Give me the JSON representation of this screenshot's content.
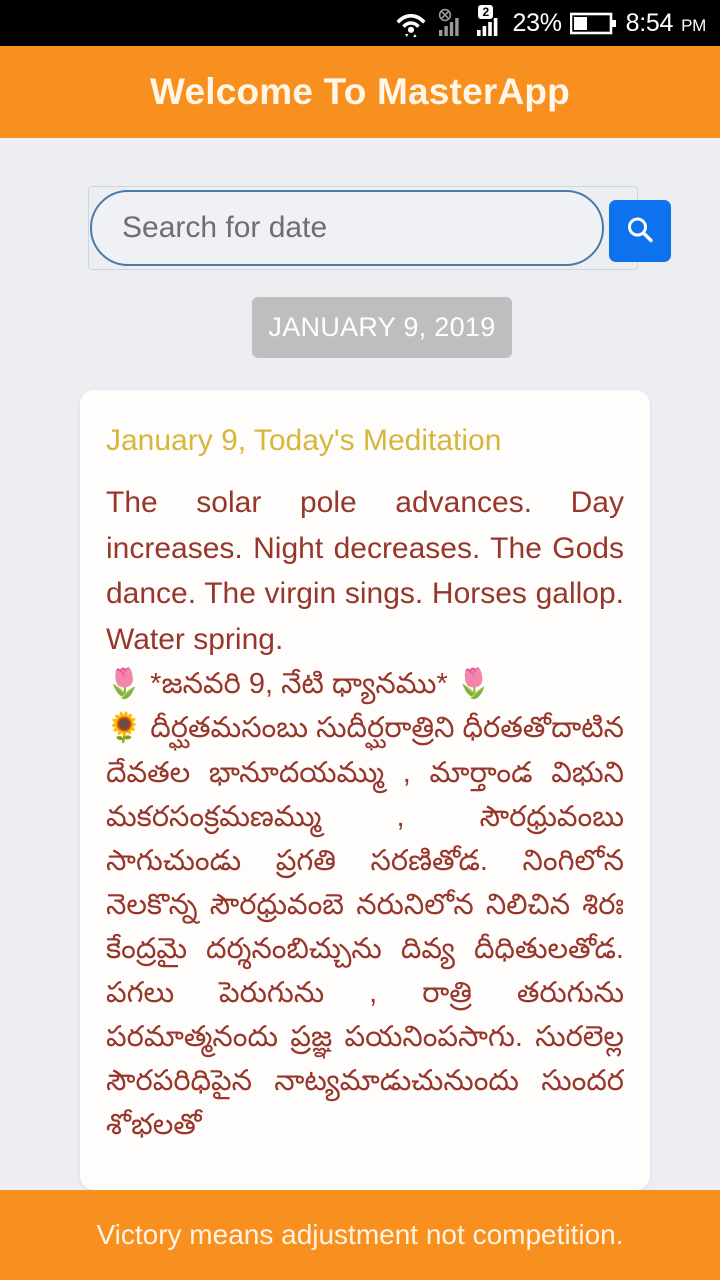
{
  "status_bar": {
    "wifi_icon": "wifi-icon",
    "sim1_icon": "sim-disabled-icon",
    "sim2_icon": "signal-bars-icon",
    "sim2_badge": "2",
    "battery_percent": "23%",
    "battery_icon": "battery-icon",
    "time": "8:54",
    "meridiem": "PM"
  },
  "app_bar": {
    "title": "Welcome To MasterApp"
  },
  "search": {
    "placeholder": "Search for date",
    "value": "",
    "button_icon": "search-icon",
    "button_color": "#0E72EE"
  },
  "date_chip": {
    "label": "JANUARY 9, 2019",
    "background": "#BEBEBE"
  },
  "card": {
    "title": "January 9, Today's Meditation",
    "title_color": "#D6B73C",
    "text_color": "#97362A",
    "english": "The solar pole advances. Day increases. Night decreases. The Gods dance. The virgin sings. Horses gallop. Water spring.",
    "telugu_heading": "🌷 *జనవరి 9, నేటి ధ్యానము* 🌷",
    "telugu_body": "🌻 దీర్ఘతమసంబు సుదీర్ఘరాత్రిని ధీరతతోదాటిన దేవతల భానూదయమ్ము , మార్తాండ విభుని మకరసంక్రమణమ్ము , సౌరధ్రువంబు సాగుచుండు ప్రగతి సరణితోడ. నింగిలోన నెలకొన్న సౌరధ్రువంబె నరునిలోన నిలిచిన శిరః కేంద్రమై దర్శనంబిచ్చును దివ్య దీధితులతోడ. పగలు పెరుగును , రాత్రి తరుగును పరమాత్మనందు ప్రజ్ఞ పయనింపసాగు. సురలెల్ల సౌరపరిధిపైన నాట్యమాడుచునుందు సుందర శోభలతో"
  },
  "footer": {
    "text": "Victory means adjustment not competition.",
    "background": "#F7901E"
  }
}
